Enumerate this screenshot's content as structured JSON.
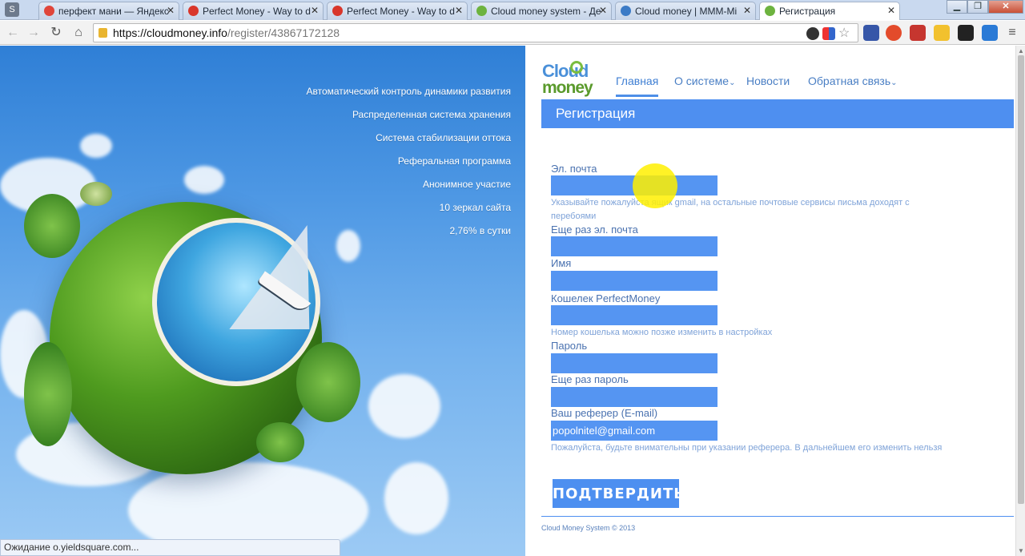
{
  "browser": {
    "tabs": [
      {
        "title": "перфект мани — Яндекс",
        "favicon_color": "#e0453a"
      },
      {
        "title": "Perfect Money - Way to d",
        "favicon_color": "#d9362b"
      },
      {
        "title": "Perfect Money - Way to d",
        "favicon_color": "#d9362b"
      },
      {
        "title": "Cloud money system - Де",
        "favicon_color": "#6db33f"
      },
      {
        "title": "Cloud money | MMM-Mi",
        "favicon_color": "#3c7bc6"
      },
      {
        "title": "Регистрация",
        "favicon_color": "#6db33f",
        "active": true
      }
    ],
    "address": {
      "scheme_host": "https://cloudmoney.info",
      "path": "/register/43867172128"
    },
    "status": "Ожидание o.yieldsquare.com..."
  },
  "hero": {
    "features": [
      "Автоматический контроль динамики развития",
      "Распределенная система хранения",
      "Система стабилизации оттока",
      "Реферальная программа",
      "Анонимное участие",
      "10 зеркал сайта",
      "2,76% в сутки"
    ]
  },
  "logo": {
    "line1": "Cloud",
    "line2": "money"
  },
  "nav": {
    "items": [
      {
        "label": "Главная",
        "active": true
      },
      {
        "label": "О системе",
        "caret": "⌄"
      },
      {
        "label": "Новости"
      },
      {
        "label": "Обратная связь",
        "caret": "⌄"
      }
    ]
  },
  "page_title": "Регистрация",
  "form": {
    "email_label": "Эл. почта",
    "email_hint": "Указывайте пожалуйста ящик gmail, на остальные почтовые сервисы письма доходят с перебоями",
    "email_repeat_label": "Еще раз эл. почта",
    "name_label": "Имя",
    "wallet_label": "Кошелек PerfectMoney",
    "wallet_hint": "Номер кошелька можно позже изменить в настройках",
    "password_label": "Пароль",
    "password_repeat_label": "Еще раз пароль",
    "referrer_label": "Ваш реферер (E-mail)",
    "referrer_value": "popolnitel@gmail.com",
    "referrer_hint": "Пожалуйста, будьте внимательны при указании реферера. В дальнейшем его изменить нельзя",
    "submit_label": "ПОДТВЕРДИТЬ"
  },
  "footer": {
    "copyright": "Cloud Money System © 2013"
  }
}
